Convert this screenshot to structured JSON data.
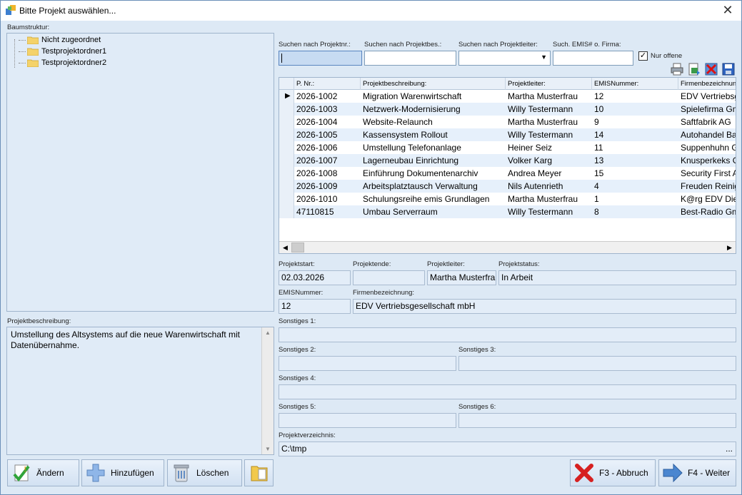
{
  "window": {
    "title": "Bitte Projekt auswählen..."
  },
  "tree": {
    "label": "Baumstruktur:",
    "items": [
      "Nicht zugeordnet",
      "Testprojektordner1",
      "Testprojektordner2"
    ]
  },
  "description": {
    "label": "Projektbeschreibung:",
    "text": "Umstellung des Altsystems auf die neue Warenwirtschaft mit Datenübernahme."
  },
  "search": {
    "nr_label": "Suchen nach Projektnr.:",
    "desc_label": "Suchen nach Projektbes.:",
    "lead_label": "Suchen nach Projektleiter:",
    "emis_label": "Such. EMIS# o. Firma:",
    "nur_offene_label": "Nur offene",
    "nur_offene_checked": "✓"
  },
  "grid": {
    "columns": [
      "P. Nr.:",
      "Projektbeschreibung:",
      "Projektleiter:",
      "EMISNummer:",
      "Firmenbezeichnung:"
    ],
    "rows": [
      [
        "2026-1002",
        "Migration Warenwirtschaft",
        "Martha Musterfrau",
        "12",
        "EDV Vertriebsgesellschaft mbH"
      ],
      [
        "2026-1003",
        "Netzwerk-Modernisierung",
        "Willy Testermann",
        "10",
        "Spielefirma GmbH"
      ],
      [
        "2026-1004",
        "Website-Relaunch",
        "Martha Musterfrau",
        "9",
        "Saftfabrik AG"
      ],
      [
        "2026-1005",
        "Kassensystem Rollout",
        "Willy Testermann",
        "14",
        "Autohandel Bauer"
      ],
      [
        "2026-1006",
        "Umstellung Telefonanlage",
        "Heiner Seiz",
        "11",
        "Suppenhuhn GmbH"
      ],
      [
        "2026-1007",
        "Lagerneubau Einrichtung",
        "Volker Karg",
        "13",
        "Knusperkeks GmbH"
      ],
      [
        "2026-1008",
        "Einführung Dokumentenarchiv",
        "Andrea Meyer",
        "15",
        "Security First AG"
      ],
      [
        "2026-1009",
        "Arbeitsplatztausch Verwaltung",
        "Nils Autenrieth",
        "4",
        "Freuden Reinigung"
      ],
      [
        "2026-1010",
        "Schulungsreihe emis Grundlagen",
        "Martha Musterfrau",
        "1",
        "K@rg EDV Dienste"
      ],
      [
        "47110815",
        "Umbau Serverraum",
        "Willy Testermann",
        "8",
        "Best-Radio GmbH"
      ]
    ]
  },
  "details": {
    "start_label": "Projektstart:",
    "start": "02.03.2026",
    "end_label": "Projektende:",
    "end": "",
    "lead_label": "Projektleiter:",
    "lead": "Martha Musterfrau",
    "status_label": "Projektstatus:",
    "status": "In Arbeit",
    "emis_label": "EMISNummer:",
    "emis": "12",
    "firma_label": "Firmenbezeichnung:",
    "firma": "EDV Vertriebsgesellschaft mbH",
    "s1_label": "Sonstiges 1:",
    "s2_label": "Sonstiges 2:",
    "s3_label": "Sonstiges 3:",
    "s4_label": "Sonstiges 4:",
    "s5_label": "Sonstiges 5:",
    "s6_label": "Sonstiges 6:",
    "dir_label": "Projektverzeichnis:",
    "dir": "C:\\tmp",
    "dir_browse": "..."
  },
  "buttons": {
    "aendern": "Ändern",
    "hinzufuegen": "Hinzufügen",
    "loeschen": "Löschen",
    "abbruch": "F3 - Abbruch",
    "weiter": "F4 - Weiter"
  }
}
